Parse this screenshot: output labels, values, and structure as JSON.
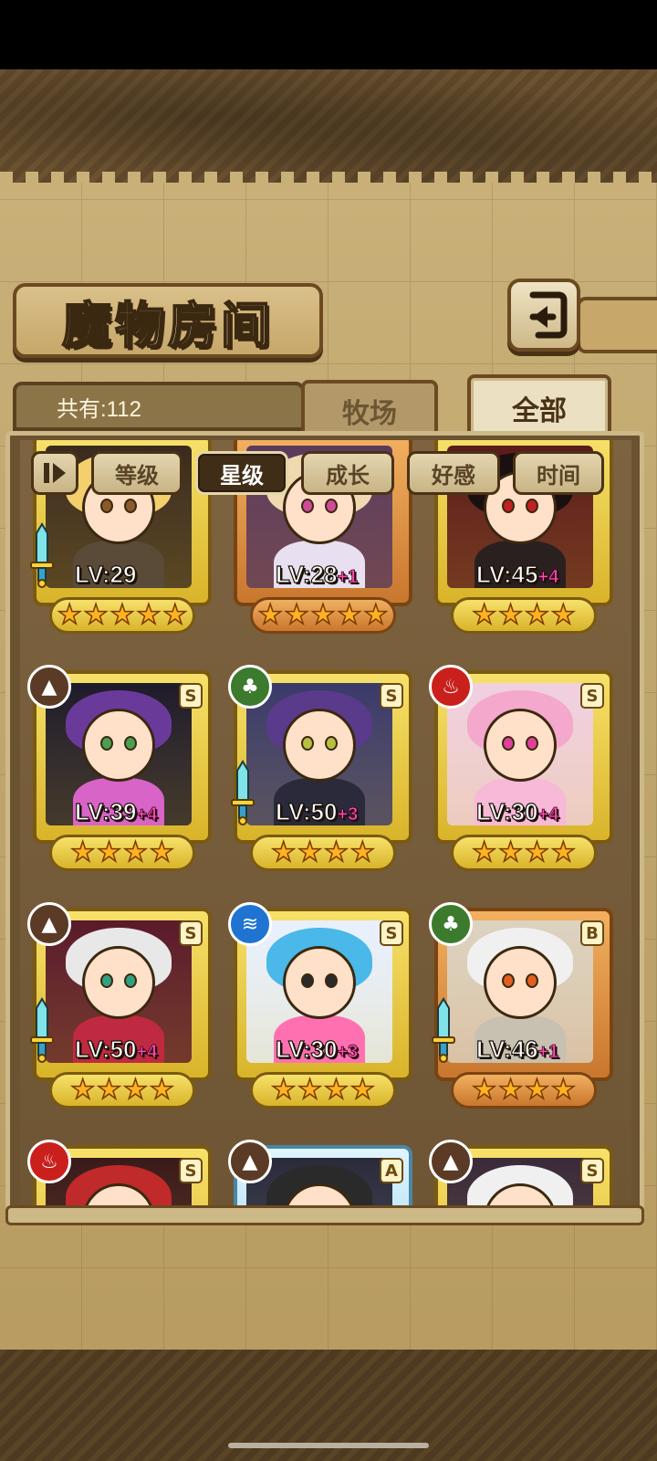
{
  "header": {
    "title": "魔物房间",
    "back_icon": "back-arrow-icon"
  },
  "tabs": [
    {
      "label": "牧场",
      "active": false
    },
    {
      "label": "全部",
      "active": true
    }
  ],
  "count_label": "共有:112",
  "sort_buttons": [
    {
      "label": "等级",
      "active": false
    },
    {
      "label": "星级",
      "active": true
    },
    {
      "label": "成长",
      "active": false
    },
    {
      "label": "好感",
      "active": false
    },
    {
      "label": "时间",
      "active": false
    }
  ],
  "monsters": [
    {
      "lv": "LV:29",
      "plus": "",
      "stars": 5,
      "rank": "",
      "element": "",
      "frame": "gold",
      "sword": true
    },
    {
      "lv": "LV:28",
      "plus": "+1",
      "stars": 5,
      "rank": "",
      "element": "",
      "frame": "bronze",
      "sword": false
    },
    {
      "lv": "LV:45",
      "plus": "+4",
      "stars": 4,
      "rank": "",
      "element": "",
      "frame": "gold",
      "sword": false
    },
    {
      "lv": "LV:39",
      "plus": "+4",
      "stars": 4,
      "rank": "S",
      "element": "earth",
      "frame": "gold",
      "sword": false
    },
    {
      "lv": "LV:50",
      "plus": "+3",
      "stars": 4,
      "rank": "S",
      "element": "leaf",
      "frame": "gold",
      "sword": true
    },
    {
      "lv": "LV:30",
      "plus": "+4",
      "stars": 4,
      "rank": "S",
      "element": "fire",
      "frame": "gold",
      "sword": false
    },
    {
      "lv": "LV:50",
      "plus": "+4",
      "stars": 4,
      "rank": "S",
      "element": "earth",
      "frame": "gold",
      "sword": true
    },
    {
      "lv": "LV:30",
      "plus": "+3",
      "stars": 4,
      "rank": "S",
      "element": "water",
      "frame": "gold",
      "sword": false
    },
    {
      "lv": "LV:46",
      "plus": "+1",
      "stars": 4,
      "rank": "B",
      "element": "leaf",
      "frame": "bronze",
      "sword": true
    },
    {
      "lv": "",
      "plus": "",
      "stars": 0,
      "rank": "S",
      "element": "fire",
      "frame": "gold",
      "sword": false
    },
    {
      "lv": "",
      "plus": "",
      "stars": 0,
      "rank": "A",
      "element": "earth",
      "frame": "silver",
      "sword": false
    },
    {
      "lv": "",
      "plus": "",
      "stars": 0,
      "rank": "S",
      "element": "earth",
      "frame": "gold",
      "sword": false
    }
  ]
}
